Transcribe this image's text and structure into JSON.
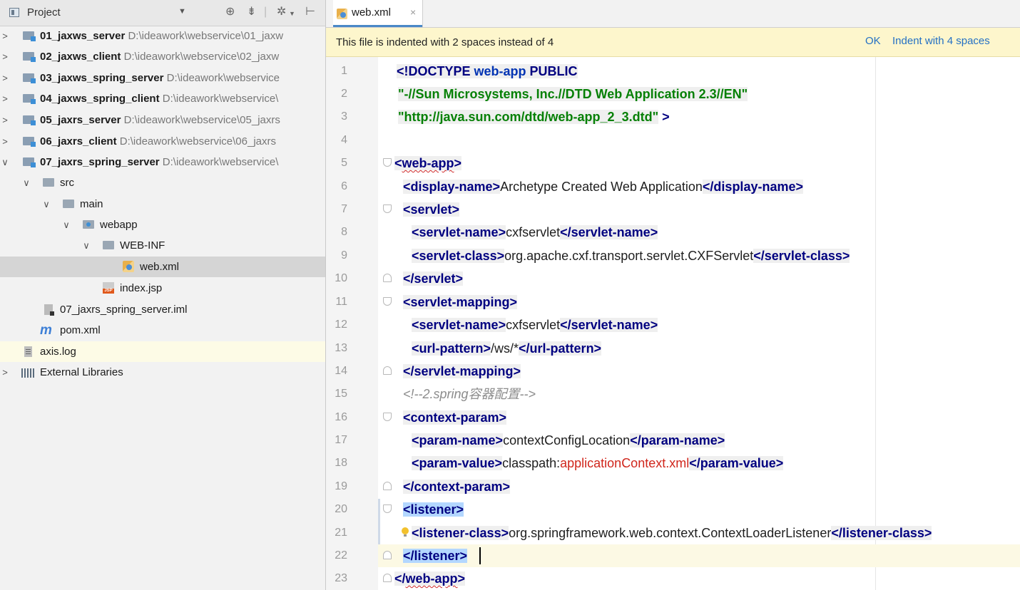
{
  "project_panel": {
    "title": "Project",
    "toolbar_icons": [
      "globe-icon",
      "collapse-all-icon",
      "gear-icon",
      "hide-icon"
    ],
    "tree": [
      {
        "kind": "module",
        "name": "01_jaxws_server",
        "path": "D:\\ideawork\\webservice\\01_jaxw",
        "expanded": false
      },
      {
        "kind": "module",
        "name": "02_jaxws_client",
        "path": "D:\\ideawork\\webservice\\02_jaxw",
        "expanded": false
      },
      {
        "kind": "module",
        "name": "03_jaxws_spring_server",
        "path": "D:\\ideawork\\webservice",
        "expanded": false
      },
      {
        "kind": "module",
        "name": "04_jaxws_spring_client",
        "path": "D:\\ideawork\\webservice\\",
        "expanded": false
      },
      {
        "kind": "module",
        "name": "05_jaxrs_server",
        "path": "D:\\ideawork\\webservice\\05_jaxrs",
        "expanded": false
      },
      {
        "kind": "module",
        "name": "06_jaxrs_client",
        "path": "D:\\ideawork\\webservice\\06_jaxrs",
        "expanded": false
      },
      {
        "kind": "module",
        "name": "07_jaxrs_spring_server",
        "path": "D:\\ideawork\\webservice\\",
        "expanded": true
      },
      {
        "kind": "folder",
        "name": "src"
      },
      {
        "kind": "folder",
        "name": "main"
      },
      {
        "kind": "folder",
        "name": "webapp"
      },
      {
        "kind": "folder",
        "name": "WEB-INF"
      },
      {
        "kind": "file",
        "name": "web.xml",
        "selected": true
      },
      {
        "kind": "file",
        "name": "index.jsp"
      },
      {
        "kind": "file",
        "name": "07_jaxrs_spring_server.iml"
      },
      {
        "kind": "file",
        "name": "pom.xml"
      },
      {
        "kind": "file",
        "name": "axis.log"
      },
      {
        "kind": "library",
        "name": "External Libraries"
      }
    ]
  },
  "editor": {
    "tab": {
      "label": "web.xml",
      "close": "×"
    },
    "notice": {
      "message": "This file is indented with 2 spaces instead of 4",
      "ok": "OK",
      "indent_action": "Indent with 4 spaces"
    },
    "line_numbers": [
      "1",
      "2",
      "3",
      "4",
      "5",
      "6",
      "7",
      "8",
      "9",
      "10",
      "11",
      "12",
      "13",
      "14",
      "15",
      "16",
      "17",
      "18",
      "19",
      "20",
      "21",
      "22",
      "23"
    ],
    "code": {
      "l1_a": "<!DOCTYPE ",
      "l1_b": "web-app",
      "l1_c": " PUBLIC",
      "l2": "\"-//Sun Microsystems, Inc.//DTD Web Application 2.3//EN\"",
      "l3_str": "\"http://java.sun.com/dtd/web-app_2_3.dtd\"",
      "l3_end": " >",
      "l5_open": "<",
      "l5_name": "web-app",
      "l5_close": ">",
      "l6_open": "<display-name>",
      "l6_text": "Archetype Created Web Application",
      "l6_close": "</display-name>",
      "l7": "<servlet>",
      "l8_open": "<servlet-name>",
      "l8_text": "cxfservlet",
      "l8_close": "</servlet-name>",
      "l9_open": "<servlet-class>",
      "l9_text": "org.apache.cxf.transport.servlet.CXFServlet",
      "l9_close": "</servlet-class>",
      "l10": "</servlet>",
      "l11": "<servlet-mapping>",
      "l12_open": "<servlet-name>",
      "l12_text": "cxfservlet",
      "l12_close": "</servlet-name>",
      "l13_open": "<url-pattern>",
      "l13_text": "/ws/*",
      "l13_close": "</url-pattern>",
      "l14": "</servlet-mapping>",
      "l15": "<!--2.spring容器配置-->",
      "l16": "<context-param>",
      "l17_open": "<param-name>",
      "l17_text": "contextConfigLocation",
      "l17_close": "</param-name>",
      "l18_open": "<param-value>",
      "l18_text_a": "classpath:",
      "l18_text_b": "applicationContext.xml",
      "l18_close": "</param-value>",
      "l19": "</context-param>",
      "l20": "<listener>",
      "l21_open": "<listener-class>",
      "l21_text": "org.springframework.web.context.ContextLoaderListener",
      "l21_close": "</listener-class>",
      "l22": "</listener>",
      "l23_open": "</",
      "l23_name": "web-app",
      "l23_close": ">"
    }
  },
  "colors": {
    "tag": "#000080",
    "string": "#068006",
    "comment": "#8c8c8c",
    "highlight": "#b3d7ff",
    "link": "#2470c4",
    "notice_bg": "#fdf6cc"
  }
}
